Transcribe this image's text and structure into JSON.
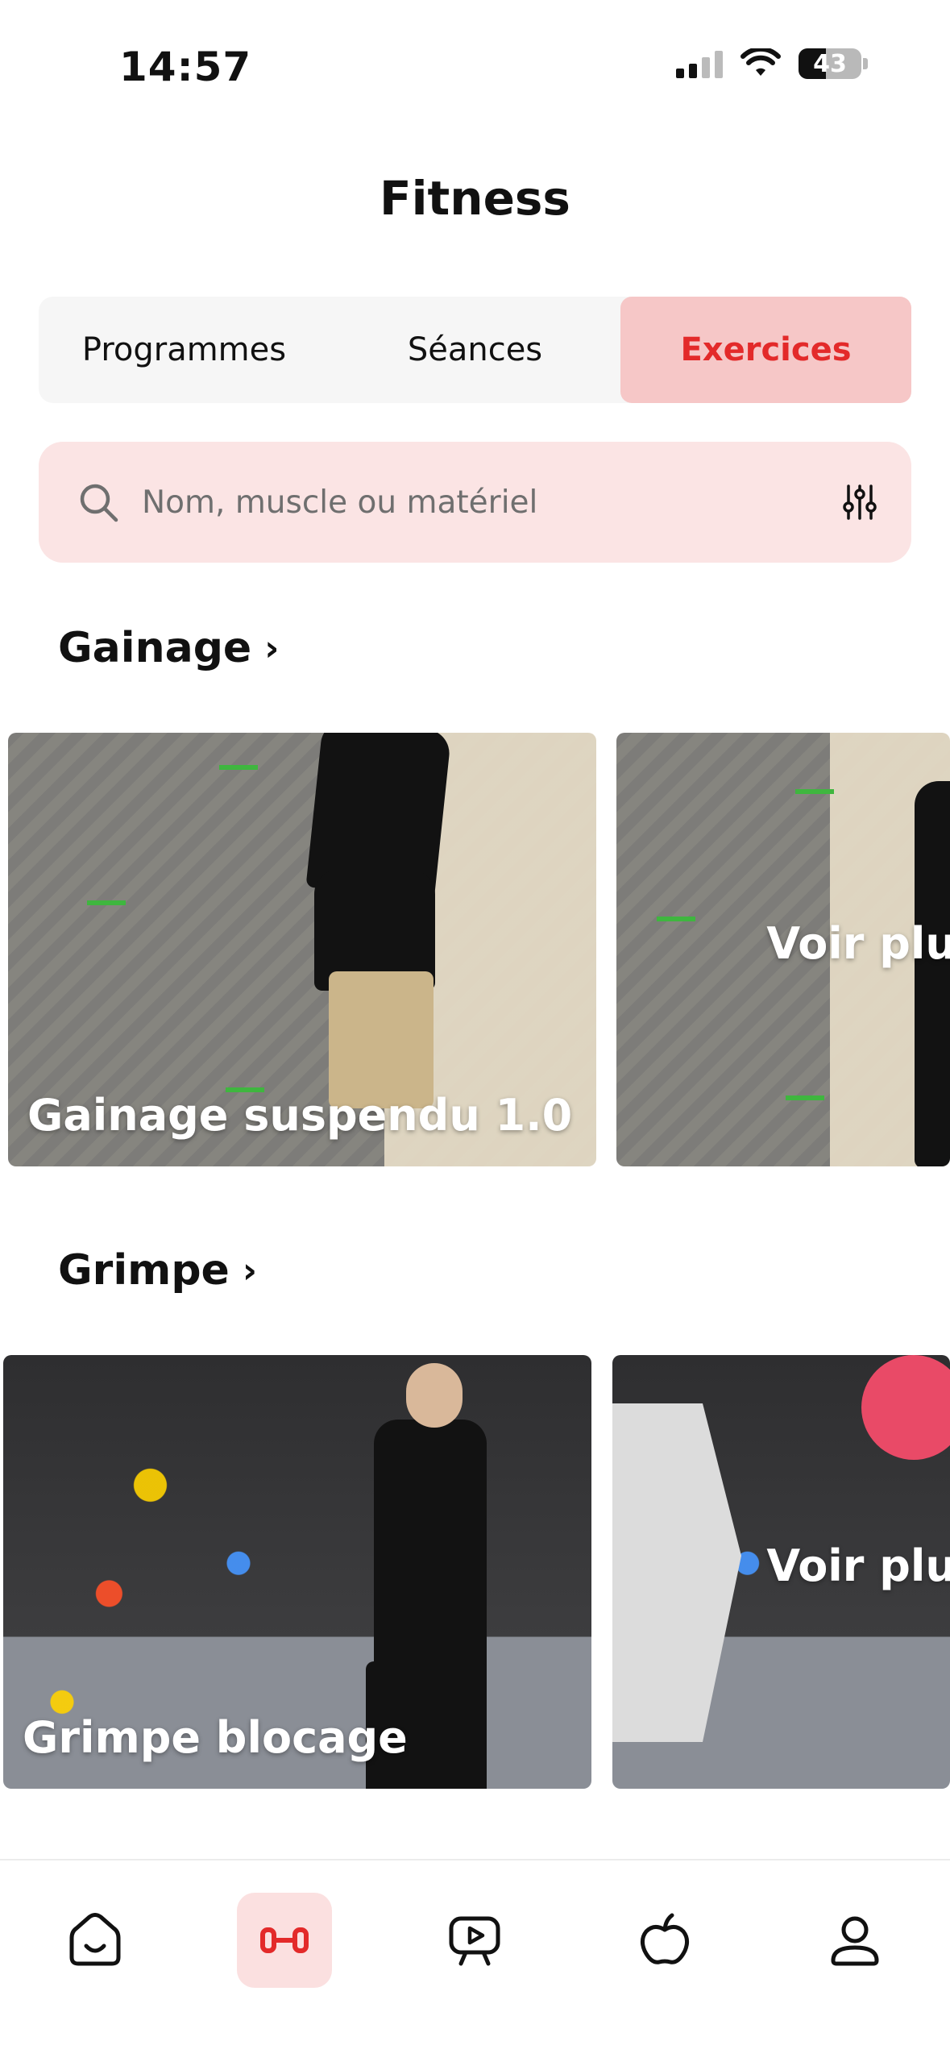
{
  "status": {
    "time": "14:57",
    "battery": "43"
  },
  "header": {
    "title": "Fitness"
  },
  "tabs": [
    {
      "label": "Programmes",
      "active": false
    },
    {
      "label": "Séances",
      "active": false
    },
    {
      "label": "Exercices",
      "active": true
    }
  ],
  "search": {
    "placeholder": "Nom, muscle ou matériel"
  },
  "sections": [
    {
      "title": "Gainage",
      "cards": [
        {
          "label": "Gainage suspendu 1.0"
        },
        {
          "label": "Voir plus"
        }
      ]
    },
    {
      "title": "Grimpe",
      "cards": [
        {
          "label": "Grimpe blocage"
        },
        {
          "label": "Voir plus"
        }
      ]
    }
  ],
  "bottom_nav": [
    {
      "icon": "home-icon",
      "active": false
    },
    {
      "icon": "dumbbell-icon",
      "active": true
    },
    {
      "icon": "video-play-icon",
      "active": false
    },
    {
      "icon": "apple-icon",
      "active": false
    },
    {
      "icon": "profile-icon",
      "active": false
    }
  ],
  "colors": {
    "accent": "#e32a2a",
    "accent_light": "#fbe4e4",
    "tab_active_bg": "#f6c7c7"
  }
}
